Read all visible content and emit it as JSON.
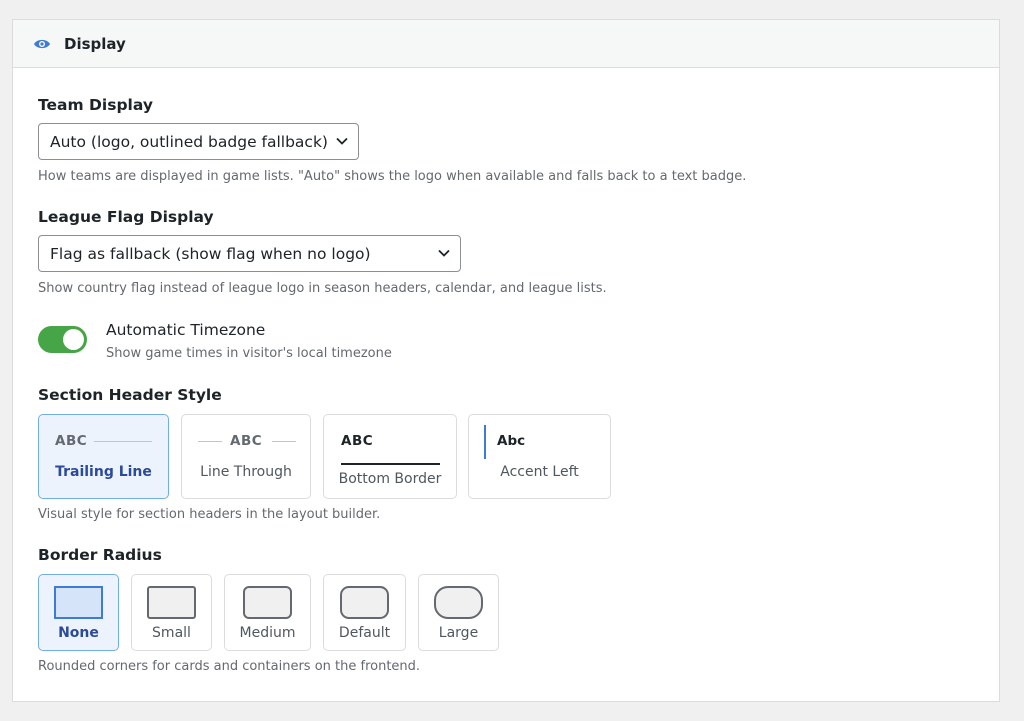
{
  "panel": {
    "title": "Display",
    "icon": "eye-icon"
  },
  "team_display": {
    "label": "Team Display",
    "value": "Auto (logo, outlined badge fallback)",
    "help": "How teams are displayed in game lists. \"Auto\" shows the logo when available and falls back to a text badge."
  },
  "league_flag": {
    "label": "League Flag Display",
    "value": "Flag as fallback (show flag when no logo)",
    "help": "Show country flag instead of league logo in season headers, calendar, and league lists."
  },
  "timezone": {
    "title": "Automatic Timezone",
    "desc": "Show game times in visitor's local timezone",
    "enabled": true
  },
  "header_style": {
    "label": "Section Header Style",
    "help": "Visual style for section headers in the layout builder.",
    "options": [
      {
        "label": "Trailing Line",
        "sample": "ABC",
        "selected": true
      },
      {
        "label": "Line Through",
        "sample": "ABC",
        "selected": false
      },
      {
        "label": "Bottom Border",
        "sample": "ABC",
        "selected": false
      },
      {
        "label": "Accent Left",
        "sample": "Abc",
        "selected": false
      }
    ]
  },
  "border_radius": {
    "label": "Border Radius",
    "help": "Rounded corners for cards and containers on the frontend.",
    "options": [
      {
        "label": "None",
        "selected": true
      },
      {
        "label": "Small",
        "selected": false
      },
      {
        "label": "Medium",
        "selected": false
      },
      {
        "label": "Default",
        "selected": false
      },
      {
        "label": "Large",
        "selected": false
      }
    ]
  },
  "colors": {
    "accent": "#3d7bd6",
    "toggle_on": "#46a546",
    "selected_text": "#2c4a9a",
    "selected_bg": "#edf3fc"
  }
}
